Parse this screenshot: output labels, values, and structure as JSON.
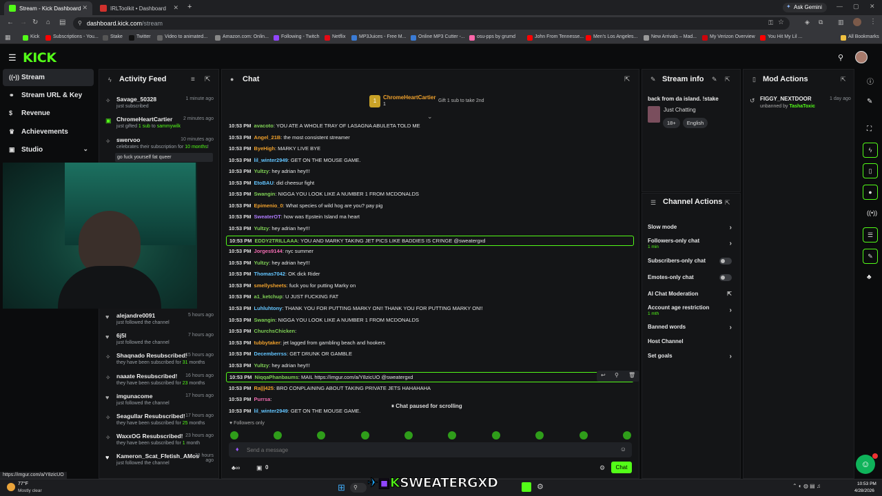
{
  "browser": {
    "tabs": [
      {
        "title": "Stream - Kick Dashboard",
        "active": true
      },
      {
        "title": "IRLToolkit • Dashboard",
        "active": false
      }
    ],
    "new_tab": "+",
    "ask_gemini": "Ask Gemini",
    "url_host": "dashboard.kick.com",
    "url_path": "/stream",
    "bookmarks": [
      "Kick",
      "Subscriptions - You...",
      "Stake",
      "Twitter",
      "Video to animated...",
      "Amazon.com: Onlin...",
      "Following - Twitch",
      "Netflix",
      "MP3Juices - Free M...",
      "Online MP3 Cutter -...",
      "osu-pps by grumd",
      "John From Tennesse...",
      "Men's Los Angeles...",
      "New Arrivals – Mad...",
      "My Verizon Overview",
      "You Hit My Lil ..."
    ],
    "all_bookmarks": "All Bookmarks"
  },
  "kick": {
    "logo": "KICK"
  },
  "sidebar": {
    "items": [
      {
        "label": "Stream",
        "icon": "broadcast-icon"
      },
      {
        "label": "Stream URL & Key",
        "icon": "link-icon"
      },
      {
        "label": "Revenue",
        "icon": "dollar-icon"
      },
      {
        "label": "Achievements",
        "icon": "trophy-icon"
      },
      {
        "label": "Studio",
        "icon": "studio-icon"
      }
    ]
  },
  "activity": {
    "title": "Activity Feed",
    "items": [
      {
        "name": "Savage_50328",
        "sub": "just subscribed",
        "time": "1 minute ago"
      },
      {
        "name": "ChromeHeartCartier",
        "sub_pre": "just gifted ",
        "sub_bold": "1 sub",
        "sub_mid": " to ",
        "sub_target": "sammywilk",
        "time": "2 minutes ago"
      },
      {
        "name": "swervoo",
        "sub_pre": "celebrates their subscription for ",
        "sub_bold": "10 months",
        "sub_post": "!",
        "time": "10 minutes ago",
        "message": "go fuck yourself fat queer"
      },
      {
        "name": "alejandre0091",
        "sub": "just followed the channel",
        "time": "5 hours ago"
      },
      {
        "name": "6j5l",
        "sub": "just followed the channel",
        "time": "7 hours ago"
      },
      {
        "name": "Shaqnado Resubscribed!",
        "sub_pre": "they have been subscribed for ",
        "sub_bold": "31",
        "sub_post": " months",
        "time": "15 hours ago"
      },
      {
        "name": "naaate Resubscribed!",
        "sub_pre": "they have been subscribed for ",
        "sub_bold": "23",
        "sub_post": " months",
        "time": "16 hours ago"
      },
      {
        "name": "imgunacome",
        "sub": "just followed the channel",
        "time": "17 hours ago"
      },
      {
        "name": "Seagullar Resubscribed!",
        "sub_pre": "they have been subscribed for ",
        "sub_bold": "25",
        "sub_post": " months",
        "time": "17 hours ago"
      },
      {
        "name": "WaxxOG Resubscribed!",
        "sub_pre": "they have been subscribed for ",
        "sub_bold": "1",
        "sub_post": " month",
        "time": "23 hours ago"
      },
      {
        "name": "Kameron_Scat_Ffetish_AMos",
        "sub": "just followed the channel",
        "time": "23 hours ago"
      }
    ]
  },
  "chat": {
    "title": "Chat",
    "pinned_user": "ChromeHeartCartier",
    "pinned_count": "1",
    "pinned_text": "Gift 1 sub to take 2nd",
    "messages": [
      {
        "time": "10:53 PM",
        "user": "avacoto",
        "color": "#7fd155",
        "text": ": YOU ATE A WHOLE TRAY OF LASAGNA ABULETA TOLD ME"
      },
      {
        "time": "10:53 PM",
        "user": "Angel_21B",
        "color": "#f0a12c",
        "text": ": the most consistent streamer"
      },
      {
        "time": "10:53 PM",
        "user": "ByeHigh",
        "color": "#f0a12c",
        "text": ": MARKY LIVE BYE"
      },
      {
        "time": "10:53 PM",
        "user": "lil_winter2949",
        "color": "#63c5ff",
        "text": ": GET ON THE MOUSE GAME."
      },
      {
        "time": "10:53 PM",
        "user": "Yultzy",
        "color": "#7fd155",
        "text": ": hey adrian hey!!!"
      },
      {
        "time": "10:53 PM",
        "user": "EtoBAU",
        "color": "#63c5ff",
        "text": ": did cheesur fight"
      },
      {
        "time": "10:53 PM",
        "user": "Swangin",
        "color": "#7fd155",
        "text": ": NIGGA YOU LOOK LIKE A NUMBER 1 FROM MCDONALDS"
      },
      {
        "time": "10:53 PM",
        "user": "Epimenio_0",
        "color": "#f0a12c",
        "text": ": What species of wild hog are you? pay pig"
      },
      {
        "time": "10:53 PM",
        "user": "SweaterOT",
        "color": "#b07cff",
        "text": ": how was Epstein Island ma heart"
      },
      {
        "time": "10:53 PM",
        "user": "Yultzy",
        "color": "#7fd155",
        "text": ": hey adrian hey!!!"
      },
      {
        "time": "10:53 PM",
        "user": "EDDY2TRILLAAA",
        "color": "#7fd155",
        "text": ": YOU AND MARKY TAKING JET PICS LIKE BADDIES IS CRINGE @sweatergxd",
        "highlight": true
      },
      {
        "time": "10:53 PM",
        "user": "Jorges9144",
        "color": "#f06bb0",
        "text": ": nyc summer"
      },
      {
        "time": "10:53 PM",
        "user": "Yultzy",
        "color": "#7fd155",
        "text": ": hey adrian hey!!!"
      },
      {
        "time": "10:53 PM",
        "user": "Thomas7042",
        "color": "#63c5ff",
        "text": ": OK dick Rider"
      },
      {
        "time": "10:53 PM",
        "user": "smellysheets",
        "color": "#f0a12c",
        "text": ": fuck you for putting Marky on"
      },
      {
        "time": "10:53 PM",
        "user": "a1_ketchup",
        "color": "#7fd155",
        "text": ": U JUST FUCKING FAT"
      },
      {
        "time": "10:53 PM",
        "user": "Luhluhtony",
        "color": "#63c5ff",
        "text": ": THANK YOU FOR PUTTING MARKY ON!! THANK YOU FOR PUTTING MARKY ON!!"
      },
      {
        "time": "10:53 PM",
        "user": "Swangin",
        "color": "#7fd155",
        "text": ": NIGGA YOU LOOK LIKE A NUMBER 1 FROM MCDONALDS"
      },
      {
        "time": "10:53 PM",
        "user": "ChurchsChicken",
        "color": "#7fd155",
        "text": ":"
      },
      {
        "time": "10:53 PM",
        "user": "tubbytaker",
        "color": "#f0a12c",
        "text": ": jet lagged from gambling beach and hookers"
      },
      {
        "time": "10:53 PM",
        "user": "Decemberrss",
        "color": "#63c5ff",
        "text": ": GET DRUNK OR GAMBLE"
      },
      {
        "time": "10:53 PM",
        "user": "Yultzy",
        "color": "#7fd155",
        "text": ": hey adrian hey!!!"
      },
      {
        "time": "10:53 PM",
        "user": "NiqqaPhanbaums",
        "color": "#7fd155",
        "text": ": MAIL https://imgur.com/a/Y8zicUO @sweatergxd",
        "highlight": true
      },
      {
        "time": "10:53 PM",
        "user": "Ra|||425",
        "color": "#f0a12c",
        "text": ": BRO CONPLAINING ABOUT TAKING PRIVATE JETS HAHAHAHA"
      },
      {
        "time": "10:53 PM",
        "user": "Purrsa",
        "color": "#f06bb0",
        "text": ":"
      },
      {
        "time": "10:53 PM",
        "user": "lil_winter2949",
        "color": "#63c5ff",
        "text": ": GET ON THE MOUSE GAME."
      }
    ],
    "paused": "Chat paused for scrolling",
    "followers_only": "Followers only",
    "input_placeholder": "Send a message",
    "viewer_count": "0",
    "send_label": "Chat"
  },
  "stream_info": {
    "title": "Stream info",
    "stream_title": "back from da island. !stake",
    "category": "Just Chatting",
    "tags": [
      "18+",
      "English"
    ]
  },
  "channel_actions": {
    "title": "Channel Actions",
    "items": [
      {
        "label": "Slow mode",
        "control": "chevron"
      },
      {
        "label": "Followers-only chat",
        "sub": "1 min",
        "control": "chevron"
      },
      {
        "label": "Subscribers-only chat",
        "control": "toggle"
      },
      {
        "label": "Emotes-only chat",
        "control": "toggle"
      },
      {
        "label": "AI Chat Moderation",
        "control": "external"
      },
      {
        "label": "Account age restriction",
        "sub": "1 mth",
        "control": "chevron"
      },
      {
        "label": "Banned words",
        "control": "chevron"
      },
      {
        "label": "Host Channel",
        "control": "none"
      },
      {
        "label": "Set goals",
        "control": "chevron"
      }
    ]
  },
  "mod_actions": {
    "title": "Mod Actions",
    "items": [
      {
        "user": "FIGGY_NEXTDOOR",
        "action": "unbanned by ",
        "by": "TashaToxic",
        "time": "1 day ago"
      }
    ]
  },
  "overlay": {
    "watermark": "SWEATERGXD"
  },
  "status": {
    "link_preview": "https://imgur.com/a/Y8zicUO"
  },
  "taskbar": {
    "weather_temp": "77°F",
    "weather_desc": "Mostly clear",
    "time": "10:53 PM",
    "date": "4/28/2026"
  },
  "colors": {
    "accent": "#53fc18",
    "panel": "#141517",
    "background": "#0b0c0d"
  }
}
